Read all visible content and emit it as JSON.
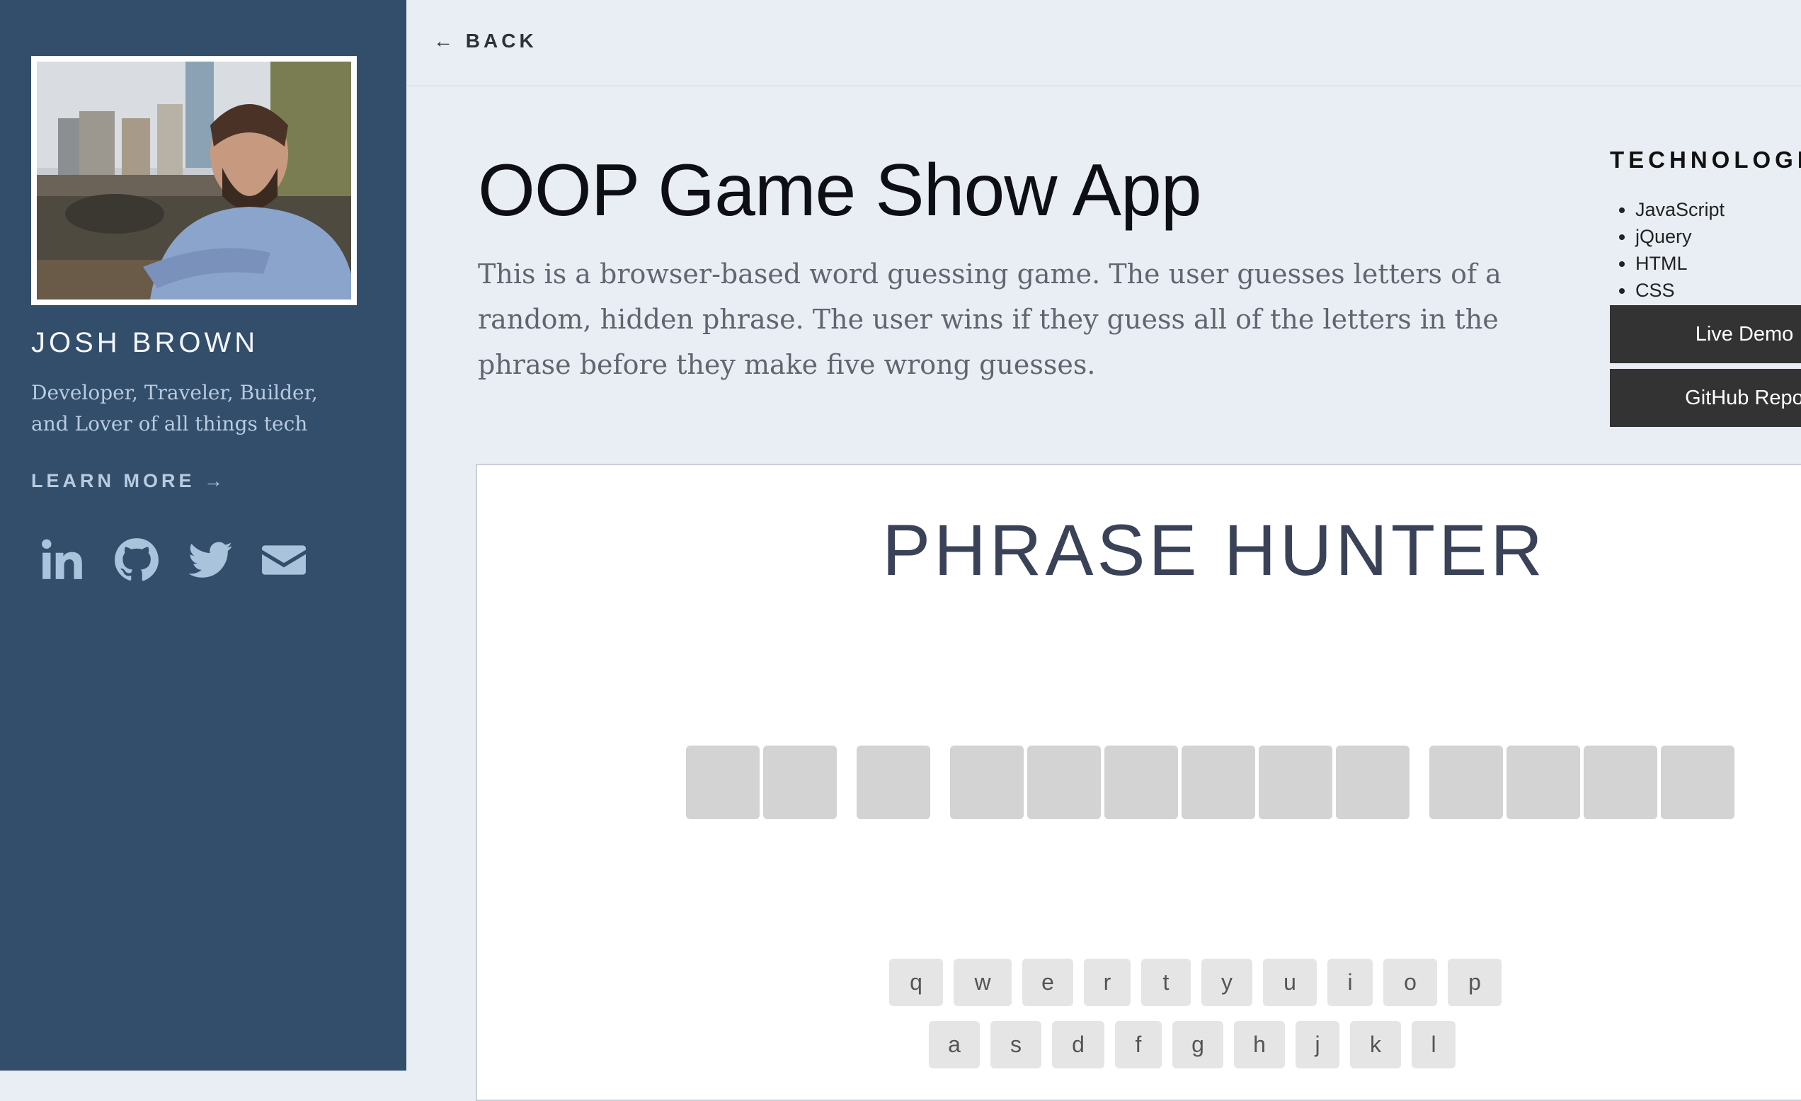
{
  "sidebar": {
    "name": "JOSH BROWN",
    "tagline": "Developer, Traveler, Builder, and Lover of all things tech",
    "learn_more": "LEARN MORE →",
    "socials": [
      "linkedin-icon",
      "github-icon",
      "twitter-icon",
      "email-icon"
    ]
  },
  "nav": {
    "back": "← BACK"
  },
  "project": {
    "title": "OOP Game Show App",
    "description": "This is a browser-based word guessing game. The user guesses letters of a random, hidden phrase. The user wins if they guess all of the letters in the phrase before they make five wrong guesses.",
    "tech_heading": "TECHNOLOGIES",
    "technologies": [
      "JavaScript",
      "jQuery",
      "HTML",
      "CSS"
    ],
    "live_demo": "Live Demo",
    "github": "GitHub Repo"
  },
  "game": {
    "title": "PHRASE HUNTER",
    "phrase_word_lengths": [
      2,
      1,
      6,
      4
    ],
    "keyboard_rows": [
      [
        "q",
        "w",
        "e",
        "r",
        "t",
        "y",
        "u",
        "i",
        "o",
        "p"
      ],
      [
        "a",
        "s",
        "d",
        "f",
        "g",
        "h",
        "j",
        "k",
        "l"
      ]
    ]
  },
  "colors": {
    "sidebar": "#324e6b",
    "page_bg": "#e8eef4",
    "button": "#333333",
    "tile": "#d3d3d3",
    "key": "#e5e5e5",
    "game_title": "#3a4258"
  }
}
